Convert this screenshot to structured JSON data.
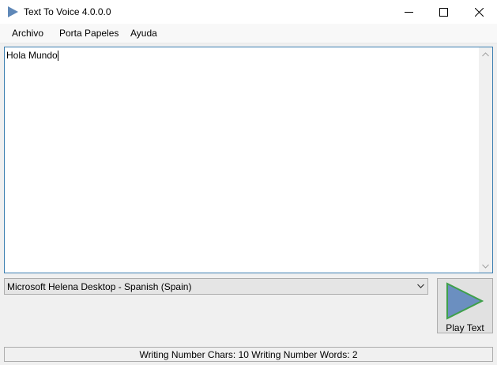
{
  "window": {
    "title": "Text To Voice 4.0.0.0",
    "icon": "play-triangle-icon",
    "controls": [
      "minimize-icon",
      "maximize-icon",
      "close-icon"
    ]
  },
  "menu": {
    "items": [
      {
        "label": "Archivo"
      },
      {
        "label": "Porta Papeles"
      },
      {
        "label": "Ayuda"
      }
    ]
  },
  "editor": {
    "text": "Hola Mundo"
  },
  "voice_select": {
    "selected": "Microsoft Helena Desktop - Spanish (Spain)"
  },
  "play_button": {
    "label": "Play Text",
    "icon": "play-triangle-icon",
    "icon_fill": "#6b8fc0",
    "icon_stroke": "#3fa04a"
  },
  "status": {
    "text": "Writing Number Chars: 10 Writing Number Words: 2"
  }
}
